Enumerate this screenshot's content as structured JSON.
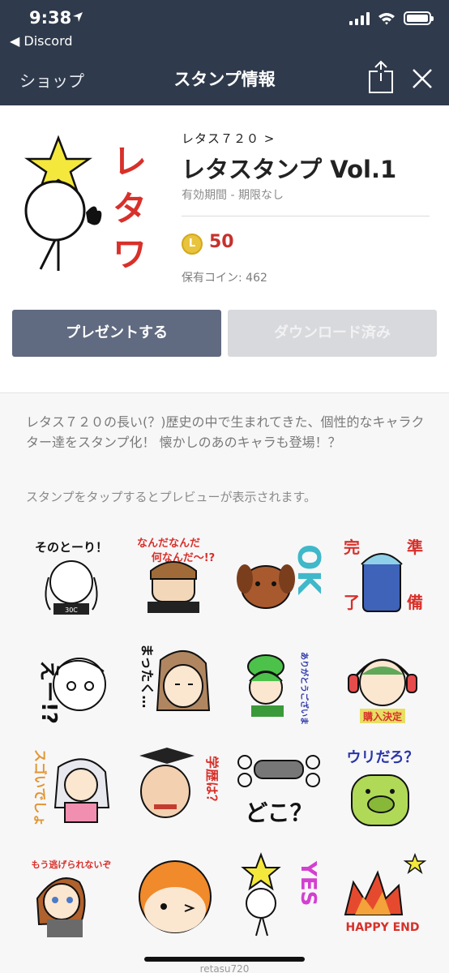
{
  "status_bar": {
    "time": "9:38",
    "back_app": "◀ Discord"
  },
  "nav": {
    "left": "ショップ",
    "title": "スタンプ情報"
  },
  "product": {
    "author": "レタス７２０ >",
    "title": "レタスタンプ Vol.1",
    "validity": "有効期間 - 期限なし",
    "coin_symbol": "L",
    "price": "50",
    "owned_coins": "保有コイン: 462",
    "thumb_text": "レタワ"
  },
  "buttons": {
    "present": "プレゼントする",
    "downloaded": "ダウンロード済み"
  },
  "description": "レタス７２０の長い(？)歴史の中で生まれてきた、個性的なキャラクター達をスタンプ化！ 懐かしのあのキャラも登場！？",
  "hint": "スタンプをタップするとプレビューが表示されます。",
  "stickers": {
    "s1": "そのとーり！",
    "s2a": "なんだなんだ",
    "s2b": "何なんだ～!?",
    "s3": "OK",
    "s4a": "完",
    "s4b": "準",
    "s4c": "了",
    "s4d": "備",
    "s5": "えー!?",
    "s6": "まったく…",
    "s7": "ありがとうございました!!",
    "s8": "購入決定",
    "s9": "スゴいでしょ",
    "s10": "学歴は？",
    "s11": "どこ？",
    "s12": "ウリだろ？",
    "s13": "もう逃げられないぞ",
    "s15": "YES",
    "s16": "HAPPY END"
  },
  "watermark": "retasu720",
  "colors": {
    "header_bg": "#2f3a4c",
    "price": "#c6312c",
    "present_btn": "#606a80",
    "coin": "#e8c33c"
  }
}
